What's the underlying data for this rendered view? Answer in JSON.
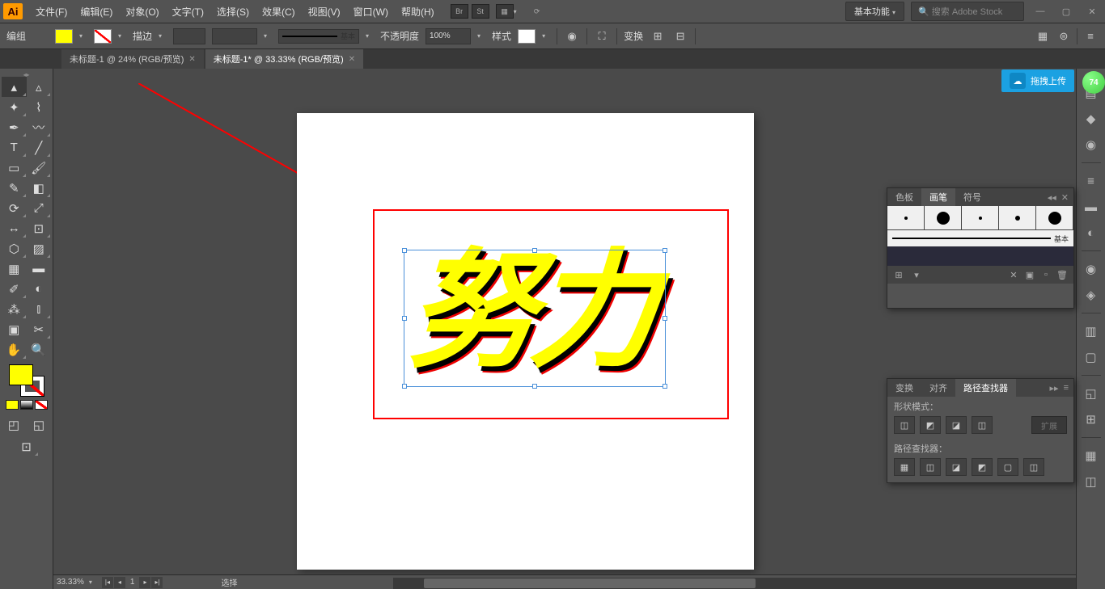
{
  "app_icon": "Ai",
  "menu": {
    "file": "文件(F)",
    "edit": "编辑(E)",
    "object": "对象(O)",
    "type": "文字(T)",
    "select": "选择(S)",
    "effect": "效果(C)",
    "view": "视图(V)",
    "window": "窗口(W)",
    "help": "帮助(H)"
  },
  "top_right": {
    "br_badge": "Br",
    "st_badge": "St",
    "workspace": "基本功能",
    "search_placeholder": "搜索 Adobe Stock"
  },
  "control": {
    "label": "编组",
    "stroke_label": "描边",
    "stroke_weight": "",
    "stroke_style_label": "基本",
    "opacity_label": "不透明度",
    "opacity_value": "100%",
    "style_label": "样式",
    "transform_label": "变换"
  },
  "tabs": {
    "tab1": "未标题-1 @ 24% (RGB/预览)",
    "tab2": "未标题-1* @ 33.33% (RGB/预览)"
  },
  "canvas": {
    "artwork_text": "努力"
  },
  "status": {
    "zoom": "33.33%",
    "artboard_num": "1",
    "mode": "选择"
  },
  "cloud": {
    "label": "拖拽上传"
  },
  "orb_value": "74",
  "brushes": {
    "tab1": "色板",
    "tab2": "画笔",
    "tab3": "符号",
    "basic_label": "基本"
  },
  "pathfinder": {
    "tab1": "变换",
    "tab2": "对齐",
    "tab3": "路径查找器",
    "shape_modes": "形状模式：",
    "pathfinders": "路径查找器：",
    "expand": "扩展"
  }
}
